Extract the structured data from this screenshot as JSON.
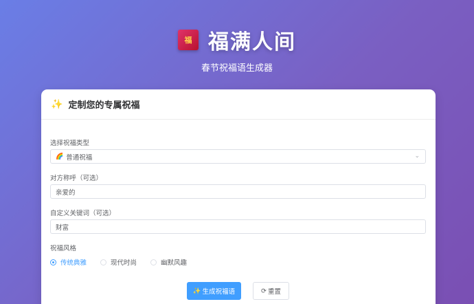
{
  "header": {
    "logo_char": "福",
    "title": "福满人间",
    "subtitle": "春节祝福语生成器"
  },
  "card": {
    "icon": "sparkles-icon",
    "title": "定制您的专属祝福"
  },
  "form": {
    "type_label": "选择祝福类型",
    "type_selected": "普通祝福",
    "type_icon": "rainbow-icon",
    "recipient_label": "对方称呼（可选）",
    "recipient_value": "亲爱的",
    "keyword_label": "自定义关键词（可选）",
    "keyword_value": "财富",
    "style_label": "祝福风格",
    "style_options": [
      "传统典雅",
      "现代时尚",
      "幽默风趣"
    ],
    "style_selected": "传统典雅"
  },
  "actions": {
    "generate_label": "生成祝福语",
    "reset_label": "重置"
  },
  "colors": {
    "primary": "#409eff",
    "bg_gradient_start": "#6a7ee6",
    "bg_gradient_end": "#7a4fb3"
  }
}
